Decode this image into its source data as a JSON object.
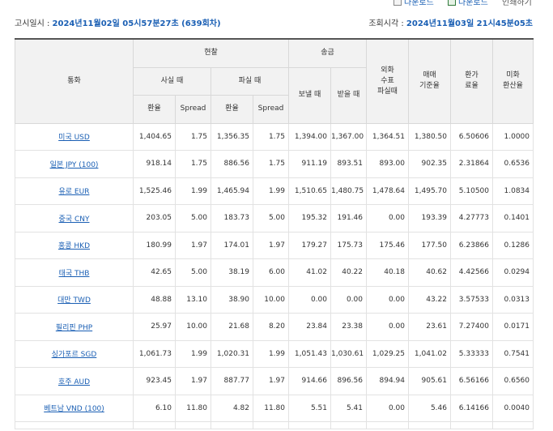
{
  "toolbar": {
    "download1": "다운로드",
    "download2": "다운로드",
    "print": "인쇄하기"
  },
  "meta": {
    "notice_label": "고시일시 :",
    "notice_value": "2024년11월02일  05시57분27초 (639회차)",
    "query_label": "조회시각 :",
    "query_value": "2024년11월03일  21시45분05초"
  },
  "table": {
    "headers": {
      "currency": "통화",
      "cash": "현찰",
      "buy": "사실 때",
      "sell": "파실 때",
      "rate": "환율",
      "spread": "Spread",
      "remit": "송금",
      "send": "보낼 때",
      "receive": "받을 때",
      "check": "외화\n수표\n파실때",
      "base": "매매\n기준율",
      "conv": "환가\n료율",
      "usd": "미화\n환산율"
    },
    "rows": [
      {
        "currency": "미국 USD",
        "buy_rate": "1,404.65",
        "buy_spread": "1.75",
        "sell_rate": "1,356.35",
        "sell_spread": "1.75",
        "send": "1,394.00",
        "receive": "1,367.00",
        "check": "1,364.51",
        "base": "1,380.50",
        "conv": "6.50606",
        "usd": "1.0000"
      },
      {
        "currency": "일본 JPY (100)",
        "buy_rate": "918.14",
        "buy_spread": "1.75",
        "sell_rate": "886.56",
        "sell_spread": "1.75",
        "send": "911.19",
        "receive": "893.51",
        "check": "893.00",
        "base": "902.35",
        "conv": "2.31864",
        "usd": "0.6536"
      },
      {
        "currency": "유로 EUR",
        "buy_rate": "1,525.46",
        "buy_spread": "1.99",
        "sell_rate": "1,465.94",
        "sell_spread": "1.99",
        "send": "1,510.65",
        "receive": "1,480.75",
        "check": "1,478.64",
        "base": "1,495.70",
        "conv": "5.10500",
        "usd": "1.0834"
      },
      {
        "currency": "중국 CNY",
        "buy_rate": "203.05",
        "buy_spread": "5.00",
        "sell_rate": "183.73",
        "sell_spread": "5.00",
        "send": "195.32",
        "receive": "191.46",
        "check": "0.00",
        "base": "193.39",
        "conv": "4.27773",
        "usd": "0.1401"
      },
      {
        "currency": "홍콩 HKD",
        "buy_rate": "180.99",
        "buy_spread": "1.97",
        "sell_rate": "174.01",
        "sell_spread": "1.97",
        "send": "179.27",
        "receive": "175.73",
        "check": "175.46",
        "base": "177.50",
        "conv": "6.23866",
        "usd": "0.1286"
      },
      {
        "currency": "태국 THB",
        "buy_rate": "42.65",
        "buy_spread": "5.00",
        "sell_rate": "38.19",
        "sell_spread": "6.00",
        "send": "41.02",
        "receive": "40.22",
        "check": "40.18",
        "base": "40.62",
        "conv": "4.42566",
        "usd": "0.0294"
      },
      {
        "currency": "대만 TWD",
        "buy_rate": "48.88",
        "buy_spread": "13.10",
        "sell_rate": "38.90",
        "sell_spread": "10.00",
        "send": "0.00",
        "receive": "0.00",
        "check": "0.00",
        "base": "43.22",
        "conv": "3.57533",
        "usd": "0.0313"
      },
      {
        "currency": "필리핀 PHP",
        "buy_rate": "25.97",
        "buy_spread": "10.00",
        "sell_rate": "21.68",
        "sell_spread": "8.20",
        "send": "23.84",
        "receive": "23.38",
        "check": "0.00",
        "base": "23.61",
        "conv": "7.27400",
        "usd": "0.0171"
      },
      {
        "currency": "싱가포르 SGD",
        "buy_rate": "1,061.73",
        "buy_spread": "1.99",
        "sell_rate": "1,020.31",
        "sell_spread": "1.99",
        "send": "1,051.43",
        "receive": "1,030.61",
        "check": "1,029.25",
        "base": "1,041.02",
        "conv": "5.33333",
        "usd": "0.7541"
      },
      {
        "currency": "호주 AUD",
        "buy_rate": "923.45",
        "buy_spread": "1.97",
        "sell_rate": "887.77",
        "sell_spread": "1.97",
        "send": "914.66",
        "receive": "896.56",
        "check": "894.94",
        "base": "905.61",
        "conv": "6.56166",
        "usd": "0.6560"
      },
      {
        "currency": "베트남 VND (100)",
        "buy_rate": "6.10",
        "buy_spread": "11.80",
        "sell_rate": "4.82",
        "sell_spread": "11.80",
        "send": "5.51",
        "receive": "5.41",
        "check": "0.00",
        "base": "5.46",
        "conv": "6.14166",
        "usd": "0.0040"
      }
    ]
  }
}
